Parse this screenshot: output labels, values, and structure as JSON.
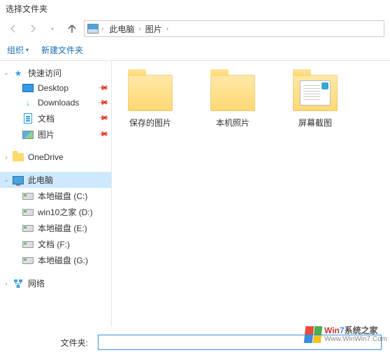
{
  "window": {
    "title": "选择文件夹"
  },
  "breadcrumb": {
    "root": "此电脑",
    "current": "图片"
  },
  "toolbar": {
    "organize": "组织",
    "new_folder": "新建文件夹"
  },
  "sidebar": {
    "quick_access": {
      "label": "快速访问",
      "expanded": true,
      "items": [
        {
          "label": "Desktop",
          "pinned": true,
          "icon": "desktop"
        },
        {
          "label": "Downloads",
          "pinned": true,
          "icon": "download"
        },
        {
          "label": "文档",
          "pinned": true,
          "icon": "document"
        },
        {
          "label": "图片",
          "pinned": true,
          "icon": "picture"
        }
      ]
    },
    "onedrive": {
      "label": "OneDrive"
    },
    "this_pc": {
      "label": "此电脑",
      "expanded": true,
      "selected": true,
      "drives": [
        {
          "label": "本地磁盘 (C:)"
        },
        {
          "label": "win10之家 (D:)"
        },
        {
          "label": "本地磁盘 (E:)"
        },
        {
          "label": "文档 (F:)"
        },
        {
          "label": "本地磁盘 (G:)"
        }
      ]
    },
    "network": {
      "label": "网络"
    }
  },
  "content": {
    "items": [
      {
        "label": "保存的图片",
        "type": "folder"
      },
      {
        "label": "本机照片",
        "type": "folder"
      },
      {
        "label": "屏幕截图",
        "type": "folder-thumb"
      }
    ]
  },
  "footer": {
    "label": "文件夹:",
    "value": ""
  },
  "watermark": {
    "line1a": "Win",
    "line1b": "7",
    "line1c": "系统之家",
    "line2": "Www.WinWin7.Com"
  }
}
